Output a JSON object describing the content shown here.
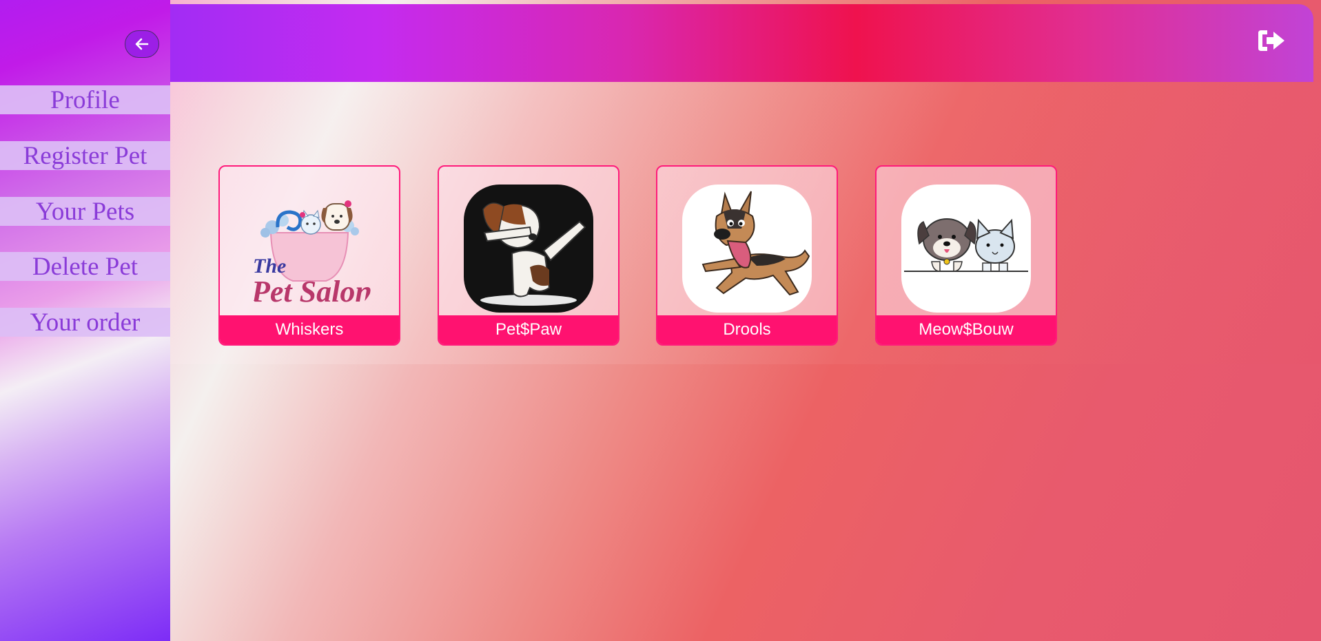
{
  "sidebar": {
    "items": [
      {
        "label": "Profile"
      },
      {
        "label": "Register Pet"
      },
      {
        "label": "Your Pets"
      },
      {
        "label": "Delete Pet"
      },
      {
        "label": "Your order"
      }
    ]
  },
  "salons": [
    {
      "name": "Whiskers",
      "logo_text_1": "The",
      "logo_text_2": "Pet Salon"
    },
    {
      "name": "Pet$Paw"
    },
    {
      "name": "Drools"
    },
    {
      "name": "Meow$Bouw"
    }
  ],
  "icons": {
    "back": "arrow-left-icon",
    "logout": "sign-out-icon"
  },
  "colors": {
    "accent": "#ff1270",
    "nav_text": "#8a3bd8"
  }
}
